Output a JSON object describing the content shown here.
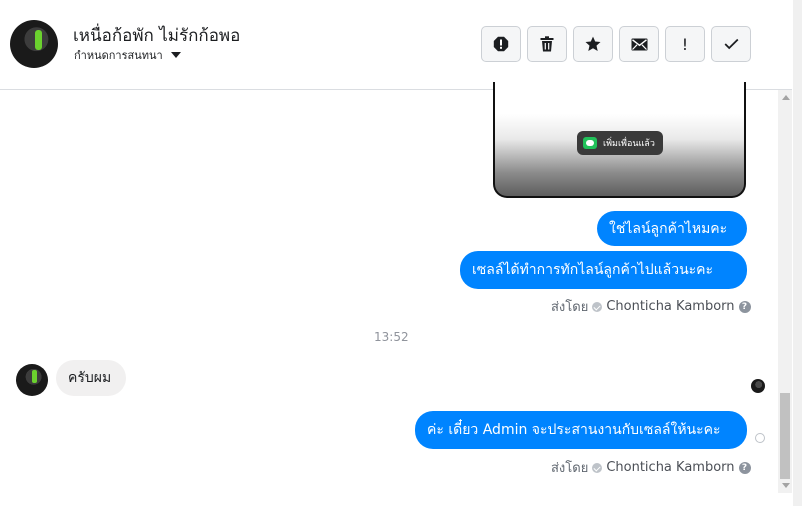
{
  "header": {
    "contact_name": "เหนื่อก้อพัก ไม่รักก้อพอ",
    "assign_label": "กำหนดการสนทนา"
  },
  "toolbar": {
    "buttons": [
      "report-icon",
      "trash-icon",
      "star-icon",
      "mail-icon",
      "exclamation-icon",
      "check-icon"
    ],
    "exclamation_glyph": "!"
  },
  "image_message": {
    "chip_text": "เพิ่มเพื่อนแล้ว"
  },
  "messages": [
    {
      "direction": "outgoing",
      "text": "ใช่ไลน์ลูกค้าไหมคะ"
    },
    {
      "direction": "outgoing",
      "text": "เซลล์ได้ทำการทักไลน์ลูกค้าไปแล้วนะคะ"
    },
    {
      "direction": "incoming",
      "text": "ครับผม"
    },
    {
      "direction": "outgoing",
      "text": "ค่ะ เดี๋ยว Admin จะประสานงานกับเซลล์ให้นะคะ"
    }
  ],
  "sent_by": {
    "label": "ส่งโดย",
    "name": "Chonticha Kamborn",
    "help_glyph": "?"
  },
  "timestamp": "13:52",
  "colors": {
    "outgoing_bubble": "#0084ff",
    "incoming_bubble": "#f1f0f0",
    "accent_green": "#6bd12e"
  }
}
